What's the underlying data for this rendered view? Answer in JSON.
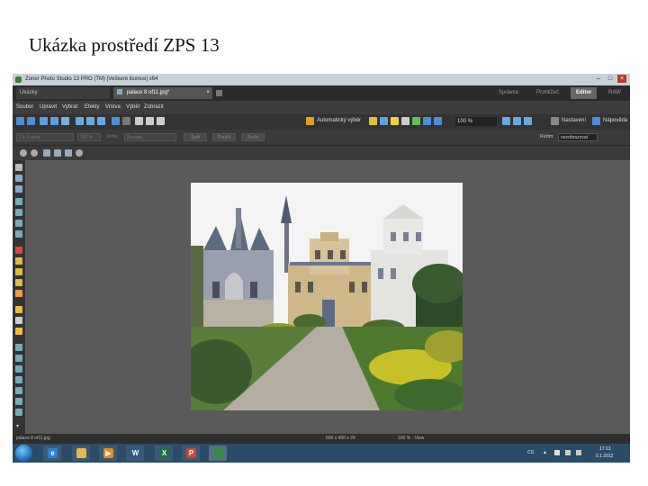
{
  "slide": {
    "title": "Ukázka prostředí ZPS 13"
  },
  "window": {
    "title": "Zoner Photo Studio 13 PRO (TM) [Veškeré licence] x64",
    "controls": {
      "minimize": "–",
      "maximize": "□",
      "close": "×"
    }
  },
  "tabs": {
    "docs": [
      {
        "label": "Ukázky"
      },
      {
        "label": "palace 8 of11.jpg*"
      }
    ],
    "doc_close": "×",
    "modes": [
      {
        "label": "Správce"
      },
      {
        "label": "Prohlížeč"
      },
      {
        "label": "Editor"
      },
      {
        "label": "RAW"
      }
    ]
  },
  "menu": {
    "items": [
      {
        "label": "Soubor"
      },
      {
        "label": "Upravit"
      },
      {
        "label": "Vybrat"
      },
      {
        "label": "Efekty"
      },
      {
        "label": "Vrstva"
      },
      {
        "label": "Výběr"
      },
      {
        "label": "Zobrazit"
      }
    ]
  },
  "toolbar": {
    "auto_correct_label": "Automatický výběr",
    "zoom": "100 %",
    "settings_label": "Nastavení",
    "help_label": "Nápověda",
    "field_label": "Režim:",
    "field_value": "nezobrazovat"
  },
  "tooloptions": {
    "preset": "1 x 1 výřez",
    "zoom": "100 %",
    "mode_label": "Volba:",
    "mode_value": "Rozsah",
    "buttons": [
      {
        "label": "Zpět"
      },
      {
        "label": "Použít"
      },
      {
        "label": "Zrušit"
      }
    ]
  },
  "status": {
    "filename": "palace 8 of11.jpg",
    "dimensions": "600 x 450 x 24",
    "zoom": "100 % - View"
  },
  "taskbar": {
    "apps": [
      {
        "name": "ie-icon",
        "glyph": "e",
        "color": "#2a7fd4"
      },
      {
        "name": "folder-icon",
        "glyph": "",
        "color": "#e8b84a"
      },
      {
        "name": "media-player-icon",
        "glyph": "▶",
        "color": "#e88a1a"
      },
      {
        "name": "word-icon",
        "glyph": "W",
        "color": "#2b5797"
      },
      {
        "name": "excel-icon",
        "glyph": "X",
        "color": "#1e7145"
      },
      {
        "name": "powerpoint-icon",
        "glyph": "P",
        "color": "#d24726"
      },
      {
        "name": "zoner-icon",
        "glyph": "",
        "color": "#3a8a4a"
      }
    ],
    "language": "CS",
    "time": "17:13",
    "date": "9.1.2012"
  }
}
